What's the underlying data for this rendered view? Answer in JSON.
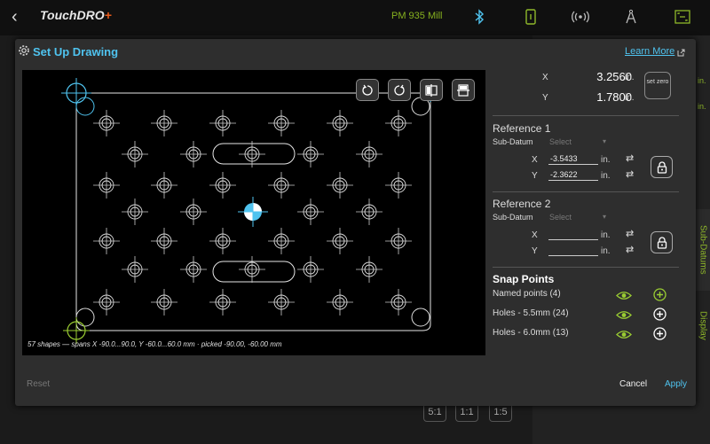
{
  "topbar": {
    "app_name": "TouchDRO",
    "app_name_suffix": "+",
    "machine": "PM 935 Mill",
    "icons": [
      "back-icon",
      "bluetooth-icon",
      "tablet-icon",
      "broadcast-icon",
      "compass-icon",
      "fit-screen-icon"
    ]
  },
  "background": {
    "side_tabs": [
      "Sub-Datums",
      "Display"
    ],
    "zoom_buttons": [
      "5:1",
      "1:1",
      "1:5"
    ],
    "partial_labels": [
      "in.",
      "in."
    ]
  },
  "modal": {
    "title": "Set Up Drawing",
    "learn_more": "Learn More",
    "canvas": {
      "tools": [
        "rotate-ccw-icon",
        "rotate-cw-icon",
        "mirror-horizontal-icon",
        "mirror-vertical-icon"
      ],
      "status": "57 shapes — spans X -90.0...90.0, Y -60.0...60.0 mm · picked -90.00, -60.00 mm"
    },
    "position": {
      "x_label": "X",
      "x_value": "3.2560",
      "x_unit": "in.",
      "y_label": "Y",
      "y_value": "1.7800",
      "y_unit": "in.",
      "set_zero": "set zero"
    },
    "reference1": {
      "title": "Reference 1",
      "sub_datum_label": "Sub-Datum",
      "sub_datum_placeholder": "Select",
      "x_label": "X",
      "x_value": "-3.5433",
      "x_unit": "in.",
      "y_label": "Y",
      "y_value": "-2.3622",
      "y_unit": "in."
    },
    "reference2": {
      "title": "Reference 2",
      "sub_datum_label": "Sub-Datum",
      "sub_datum_placeholder": "Select",
      "x_label": "X",
      "x_value": "",
      "x_unit": "in.",
      "y_label": "Y",
      "y_value": "",
      "y_unit": "in."
    },
    "snap": {
      "title": "Snap Points",
      "rows": [
        {
          "label": "Named points (4)",
          "eye_color": "#9acd32",
          "plus_color": "#9acd32"
        },
        {
          "label": "Holes - 5.5mm (24)",
          "eye_color": "#9acd32",
          "plus_color": "#ffffff"
        },
        {
          "label": "Holes - 6.0mm (13)",
          "eye_color": "#9acd32",
          "plus_color": "#ffffff"
        }
      ]
    },
    "footer": {
      "reset": "Reset",
      "cancel": "Cancel",
      "apply": "Apply"
    }
  },
  "colors": {
    "accent": "#4fc3ef",
    "green": "#86b11f",
    "pro_orange": "#e85a1a"
  }
}
